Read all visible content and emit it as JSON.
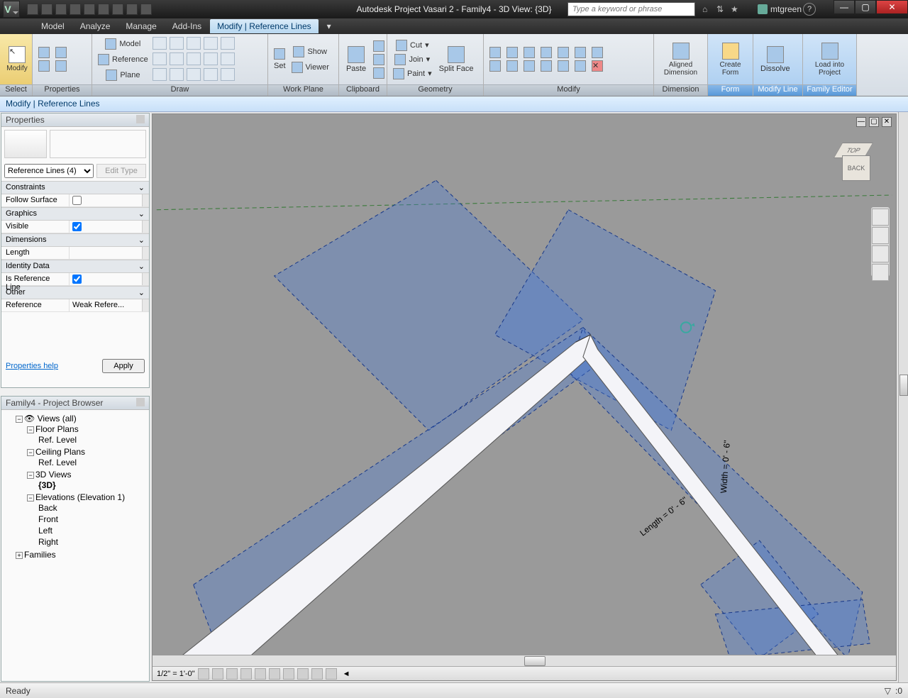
{
  "title": "Autodesk Project Vasari 2  -   Family4 - 3D View: {3D}",
  "search_placeholder": "Type a keyword or phrase",
  "user": "mtgreen",
  "tabs": [
    "Model",
    "Analyze",
    "Manage",
    "Add-Ins",
    "Modify | Reference Lines"
  ],
  "context_text": "Modify | Reference Lines",
  "ribbon": {
    "select": "Select",
    "properties": "Properties",
    "draw": "Draw",
    "draw_model": "Model",
    "draw_reference": "Reference",
    "draw_plane": "Plane",
    "workplane": "Work Plane",
    "workplane_set": "Set",
    "workplane_show": "Show",
    "workplane_viewer": "Viewer",
    "clipboard": "Clipboard",
    "clipboard_paste": "Paste",
    "geometry": "Geometry",
    "geom_cut": "Cut",
    "geom_join": "Join",
    "geom_paint": "Paint",
    "geom_split": "Split Face",
    "modify": "Modify",
    "modify_label": "Modify",
    "dimension": "Dimension",
    "dim_aligned": "Aligned Dimension",
    "form": "Form",
    "form_create": "Create Form",
    "modifyline": "Modify Line",
    "dissolve": "Dissolve",
    "familyeditor": "Family Editor",
    "load_project": "Load into Project"
  },
  "properties": {
    "header": "Properties",
    "selector": "Reference Lines (4)",
    "edit_type": "Edit Type",
    "groups": {
      "constraints": "Constraints",
      "follow_surface": "Follow Surface",
      "graphics": "Graphics",
      "visible": "Visible",
      "dimensions": "Dimensions",
      "length": "Length",
      "identity": "Identity Data",
      "is_ref_line": "Is Reference Line",
      "other": "Other",
      "reference": "Reference",
      "reference_val": "Weak Refere..."
    },
    "help": "Properties help",
    "apply": "Apply"
  },
  "browser": {
    "header": "Family4 - Project Browser",
    "views": "Views (all)",
    "floor_plans": "Floor Plans",
    "ref_level": "Ref. Level",
    "ceiling_plans": "Ceiling Plans",
    "3d_views": "3D Views",
    "3d": "{3D}",
    "elevations": "Elevations (Elevation 1)",
    "back": "Back",
    "front": "Front",
    "left": "Left",
    "right": "Right",
    "families": "Families"
  },
  "viewcube": {
    "top": "TOP",
    "back": "BACK"
  },
  "annotations": {
    "length": "Length = 0' - 6\"",
    "width": "Width = 0' - 6\""
  },
  "viewbar": {
    "scale": "1/2\" = 1'-0\""
  },
  "status": {
    "ready": "Ready",
    "filter": ":0"
  }
}
